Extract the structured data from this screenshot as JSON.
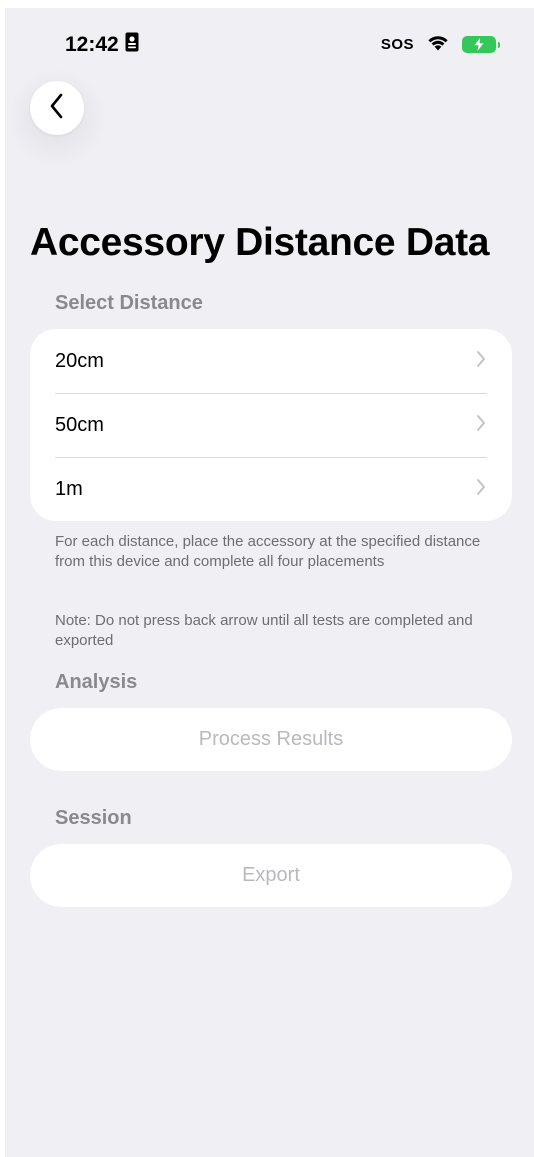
{
  "status_bar": {
    "time": "12:42",
    "sos": "SOS",
    "icons": [
      "contact-card-icon",
      "wifi-icon",
      "battery-charging-icon"
    ],
    "battery_color": "#34c759"
  },
  "nav": {
    "back_icon": "chevron-left-icon"
  },
  "page": {
    "title": "Accessory Distance Data"
  },
  "select_distance": {
    "header": "Select Distance",
    "items": [
      {
        "label": "20cm"
      },
      {
        "label": "50cm"
      },
      {
        "label": "1m"
      }
    ],
    "footnote": "For each distance, place the accessory at the specified distance from this device and complete all four placements",
    "note": "Note: Do not press back arrow until all tests are completed and exported"
  },
  "analysis": {
    "header": "Analysis",
    "button_label": "Process Results"
  },
  "session": {
    "header": "Session",
    "button_label": "Export"
  },
  "colors": {
    "background": "#efeff4",
    "card": "#ffffff",
    "secondary_text": "#8a8a8e",
    "disabled_text": "#b9b9be"
  }
}
